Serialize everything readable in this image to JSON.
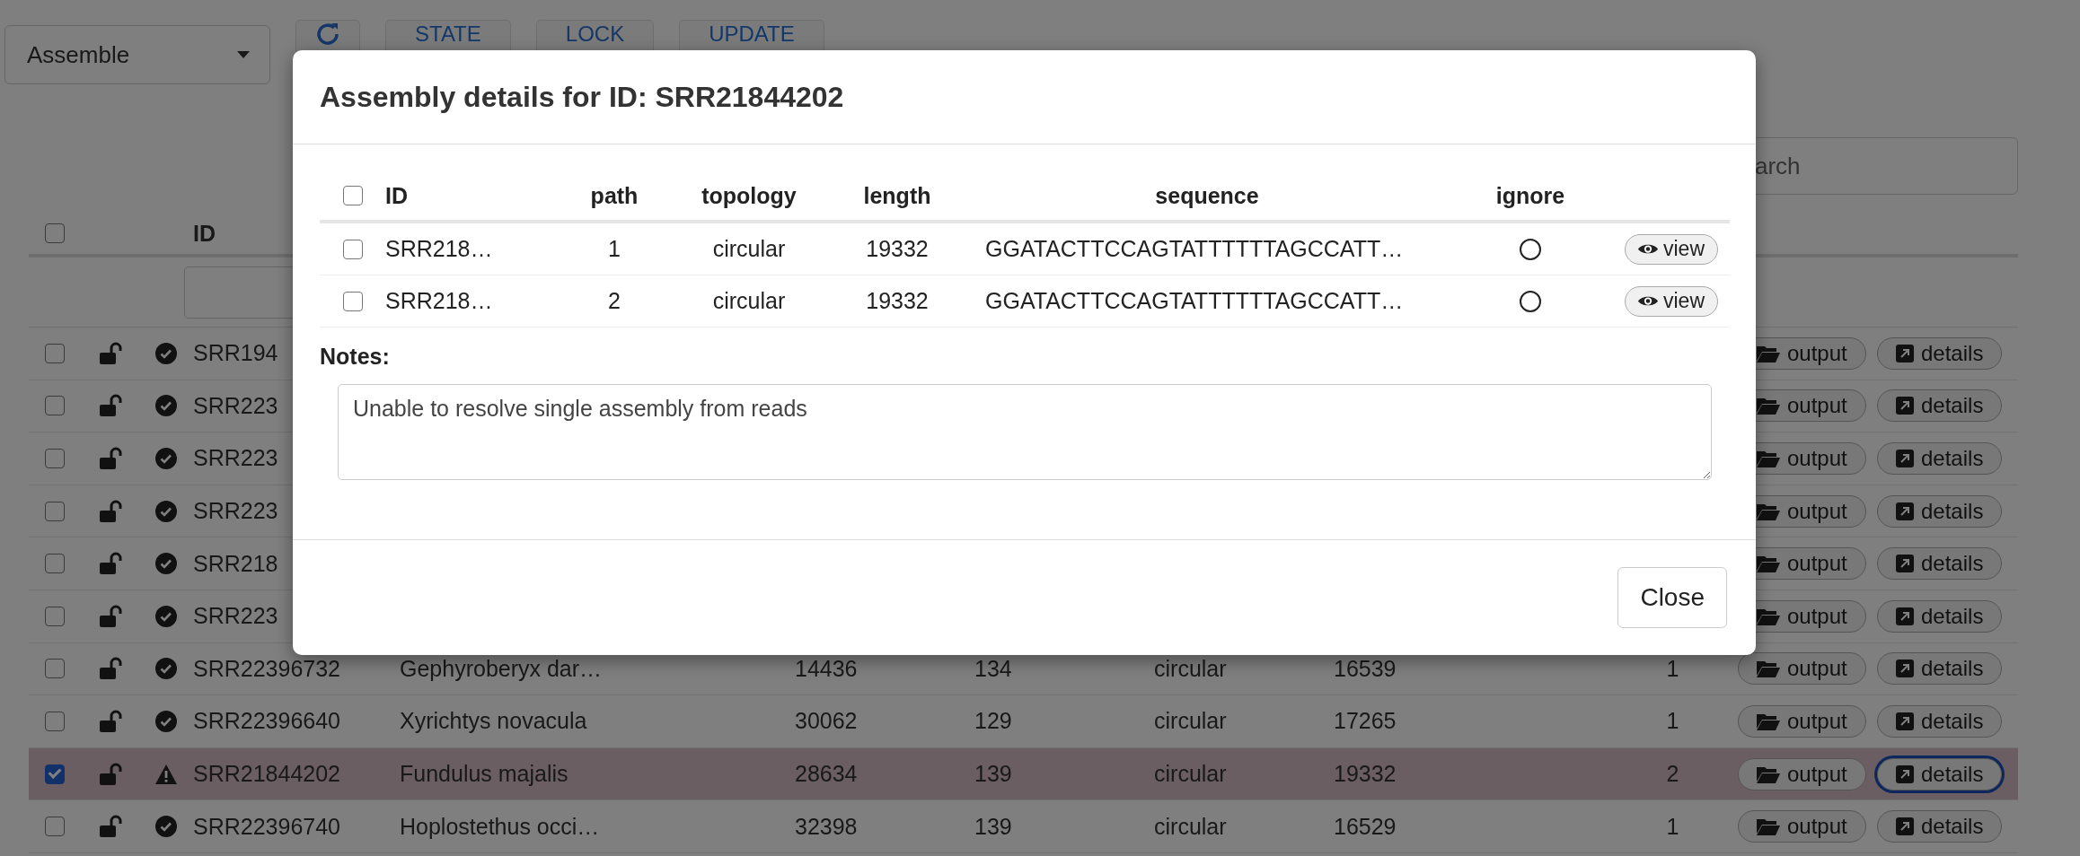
{
  "toolbar": {
    "mode_select": "Assemble",
    "buttons": [
      "STATE",
      "LOCK",
      "UPDATE"
    ]
  },
  "search": {
    "placeholder": "arch"
  },
  "table": {
    "all_checked": false,
    "columns": [
      "ID"
    ],
    "rows": [
      {
        "checked": false,
        "selected": false,
        "locked": false,
        "kind": "ok",
        "id": "SRR194",
        "output": "output",
        "details": "details",
        "details_focused": false
      },
      {
        "checked": false,
        "selected": false,
        "locked": false,
        "kind": "ok",
        "id": "SRR223",
        "output": "output",
        "details": "details",
        "details_focused": false
      },
      {
        "checked": false,
        "selected": false,
        "locked": false,
        "kind": "ok",
        "id": "SRR223",
        "output": "output",
        "details": "details",
        "details_focused": false
      },
      {
        "checked": false,
        "selected": false,
        "locked": false,
        "kind": "ok",
        "id": "SRR223",
        "output": "output",
        "details": "details",
        "details_focused": false
      },
      {
        "checked": false,
        "selected": false,
        "locked": false,
        "kind": "ok",
        "id": "SRR218",
        "output": "output",
        "details": "details",
        "details_focused": false
      },
      {
        "checked": false,
        "selected": false,
        "locked": false,
        "kind": "ok",
        "id": "SRR223",
        "output": "output",
        "details": "details",
        "details_focused": false
      },
      {
        "checked": false,
        "selected": false,
        "locked": false,
        "kind": "ok",
        "id": "SRR22396732",
        "cells": [
          "Gephyroberyx dar…",
          "14436",
          "134",
          "circular",
          "16539",
          "1"
        ],
        "output": "output",
        "details": "details",
        "details_focused": false
      },
      {
        "checked": false,
        "selected": false,
        "locked": false,
        "kind": "ok",
        "id": "SRR22396640",
        "cells": [
          "Xyrichtys novacula",
          "30062",
          "129",
          "circular",
          "17265",
          "1"
        ],
        "output": "output",
        "details": "details",
        "details_focused": false
      },
      {
        "checked": true,
        "selected": true,
        "locked": false,
        "kind": "warning",
        "id": "SRR21844202",
        "cells": [
          "Fundulus majalis",
          "28634",
          "139",
          "circular",
          "19332",
          "2"
        ],
        "output": "output",
        "details": "details",
        "details_focused": true
      },
      {
        "checked": false,
        "selected": false,
        "locked": false,
        "kind": "ok",
        "id": "SRR22396740",
        "cells": [
          "Hoplostethus occi…",
          "32398",
          "139",
          "circular",
          "16529",
          "1"
        ],
        "output": "output",
        "details": "details",
        "details_focused": false
      }
    ]
  },
  "modal": {
    "title": "Assembly details for ID: SRR21844202",
    "all_checked": false,
    "columns": [
      "ID",
      "path",
      "topology",
      "length",
      "sequence",
      "ignore"
    ],
    "rows": [
      {
        "checked": false,
        "id": "SRR218…",
        "path": "1",
        "topology": "circular",
        "length": "19332",
        "sequence": "GGATACTTCCAGTATTTTTTAGCCATT…",
        "ignored": false,
        "button": "view"
      },
      {
        "checked": false,
        "id": "SRR218…",
        "path": "2",
        "topology": "circular",
        "length": "19332",
        "sequence": "GGATACTTCCAGTATTTTTTAGCCATT…",
        "ignored": false,
        "button": "view"
      }
    ],
    "notes_label": "Notes:",
    "notes": "Unable to resolve single assembly from reads",
    "close": "Close"
  }
}
